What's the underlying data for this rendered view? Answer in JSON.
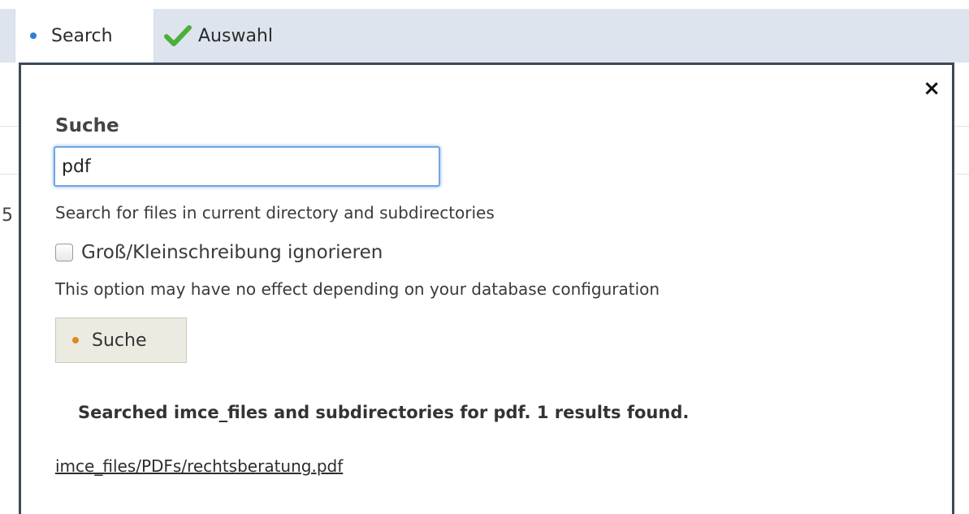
{
  "tabs": [
    {
      "label": "Search",
      "icon": "bullet-icon",
      "active": true
    },
    {
      "label": "Auswahl",
      "icon": "checkmark-icon",
      "active": false
    }
  ],
  "background": {
    "partial_text": "5"
  },
  "popup": {
    "close_symbol": "×",
    "search_label": "Suche",
    "search_value": "pdf",
    "search_help": "Search for files in current directory and subdirectories",
    "case_checkbox_label": "Groß/Kleinschreibung ignorieren",
    "case_checkbox_checked": false,
    "case_help": "This option may have no effect depending on your database configuration",
    "submit_label": "Suche",
    "result_summary": "Searched imce_files and subdirectories for pdf. 1 results found.",
    "results": [
      "imce_files/PDFs/rechtsberatung.pdf"
    ]
  },
  "colors": {
    "toolbar_bg": "#dde4ee",
    "popup_border": "#3c4a59",
    "input_focus": "#6fa6e8",
    "bullet_blue": "#2f7fd6",
    "bullet_orange": "#e08a1b",
    "check_green": "#4caf3a"
  }
}
